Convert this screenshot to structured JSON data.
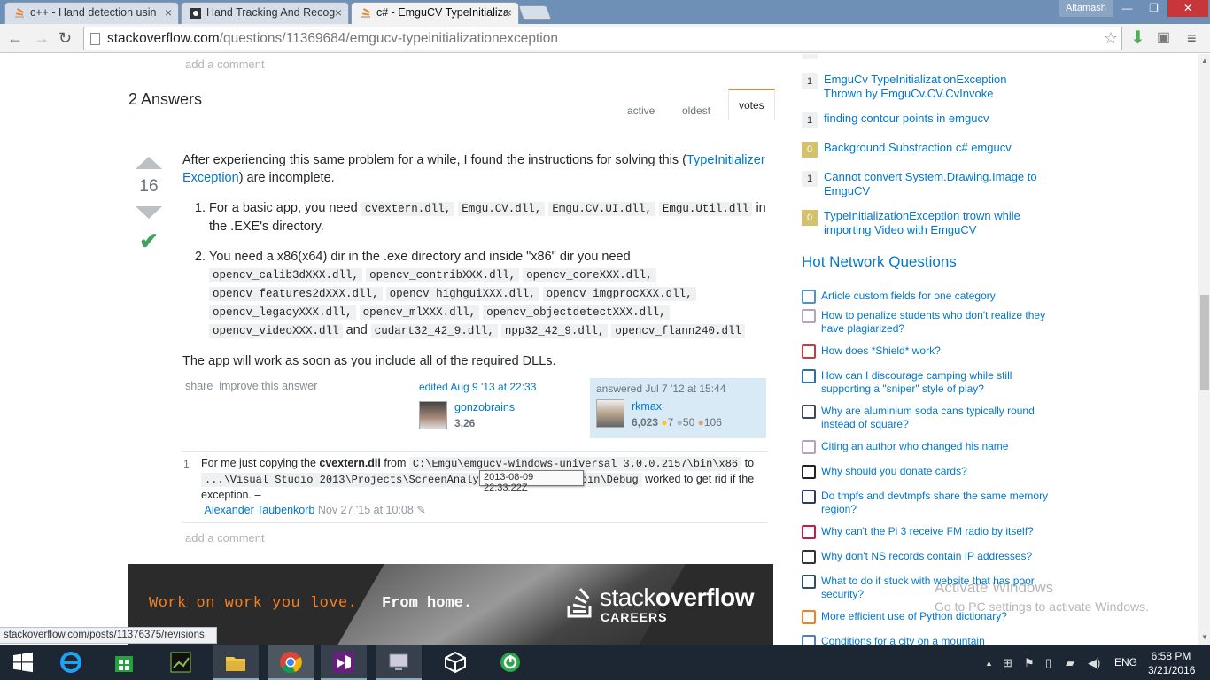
{
  "browser": {
    "tabs": [
      {
        "label": "c++ - Hand detection usin",
        "icon": "stackoverflow-icon"
      },
      {
        "label": "Hand Tracking And Recog",
        "icon": "page-icon"
      },
      {
        "label": "c# - EmguCV TypeInitializa",
        "icon": "stackoverflow-icon",
        "active": true
      }
    ],
    "user": "Altamash",
    "url_domain": "stackoverflow.com",
    "url_path": "/questions/11369684/emgucv-typeinitializationexception",
    "status_url": "stackoverflow.com/posts/11376375/revisions"
  },
  "question": {
    "add_comment": "add a comment"
  },
  "answers": {
    "title": "2 Answers",
    "sort_tabs": [
      "active",
      "oldest",
      "votes"
    ],
    "selected_sort": "votes"
  },
  "answer": {
    "score": "16",
    "intro_1": "After experiencing this same problem for a while, I found the instructions for solving this",
    "intro_link": "TypeInitializer Exception",
    "intro_2": "are incomplete.",
    "step1_text": "For a basic app, you need",
    "step1_dlls": [
      "cvextern.dll,",
      "Emgu.CV.dll,",
      "Emgu.CV.UI.dll,",
      "Emgu.Util.dll"
    ],
    "step1_tail": "in the .EXE's directory.",
    "step2_text": "You need a x86(x64) dir in the .exe directory and inside \"x86\" dir you need",
    "step2_dlls": [
      "opencv_calib3dXXX.dll,",
      "opencv_contribXXX.dll,",
      "opencv_coreXXX.dll,",
      "opencv_features2dXXX.dll,",
      "opencv_highguiXXX.dll,",
      "opencv_imgprocXXX.dll,",
      "opencv_legacyXXX.dll,",
      "opencv_mlXXX.dll,",
      "opencv_objectdetectXXX.dll,",
      "opencv_videoXXX.dll"
    ],
    "step2_and": "and",
    "step2_dlls2": [
      "cudart32_42_9.dll,",
      "npp32_42_9.dll,",
      "opencv_flann240.dll"
    ],
    "closing": "The app will work as soon as you include all of the required DLLs.",
    "menu_share": "share",
    "menu_improve": "improve this answer",
    "edited": {
      "label": "edited Aug 9 '13 at 22:33",
      "user": "gonzobrains",
      "rep": "3,26",
      "tooltip": "2013-08-09 22:33:22Z"
    },
    "owner": {
      "label": "answered Jul 7 '12 at 15:44",
      "user": "rkmax",
      "rep": "6,023",
      "gold": "7",
      "silver": "50",
      "bronze": "106"
    }
  },
  "comment": {
    "score": "1",
    "t1": "For me just copying the",
    "bold": "cvextern.dll",
    "t2": "from",
    "code1": "C:\\Emgu\\emgucv-windows-universal 3.0.0.2157\\bin\\x86",
    "t3": "to",
    "code2": "...\\Visual Studio 2013\\Projects\\ScreenAnalyzer\\TestProject\\bin\\Debug",
    "t4": "worked to get rid if the exception. –",
    "author": "Alexander Taubenkorb",
    "date": "Nov 27 '15 at 10:08",
    "add_comment": "add a comment"
  },
  "banner": {
    "t1": "Work on work you love.",
    "t2": "From home.",
    "logo_stack": "stack",
    "logo_overflow": "overflow",
    "careers": "CAREERS"
  },
  "related": [
    {
      "score": "1",
      "title": "EmguCv TypeInitializationException Thrown by EmguCv.CV.CvInvoke",
      "kind": "plain"
    },
    {
      "score": "1",
      "title": "finding contour points in emgucv",
      "kind": "plain"
    },
    {
      "score": "0",
      "title": "Background Substraction c# emgucv",
      "kind": "zero"
    },
    {
      "score": "1",
      "title": "Cannot convert System.Drawing.Image to EmguCV",
      "kind": "plain"
    },
    {
      "score": "0",
      "title": "TypeInitializationException trown while importing Video with EmguCV",
      "kind": "zero"
    }
  ],
  "hnq": {
    "title": "Hot Network Questions",
    "items": [
      {
        "title": "Article custom fields for one category",
        "icon": "joomla-icon",
        "color": "#5091cd"
      },
      {
        "title": "How to penalize students who don't realize they have plagiarized?",
        "icon": "academia-icon",
        "color": "#b6a1c5"
      },
      {
        "title": "How does *Shield* work?",
        "icon": "rpg-icon",
        "color": "#c23d3d"
      },
      {
        "title": "How can I discourage camping while still supporting a \"sniper\" style of play?",
        "icon": "gamedev-icon",
        "color": "#2a6db5"
      },
      {
        "title": "Why are aluminium soda cans typically round instead of square?",
        "icon": "engineering-icon",
        "color": "#3b4a5e"
      },
      {
        "title": "Citing an author who changed his name",
        "icon": "academia-icon",
        "color": "#b6a1c5"
      },
      {
        "title": "Why should you donate cards?",
        "icon": "boardgames-icon",
        "color": "#222"
      },
      {
        "title": "Do tmpfs and devtmpfs share the same memory region?",
        "icon": "unix-icon",
        "color": "#2b3a6a"
      },
      {
        "title": "Why can't the Pi 3 receive FM radio by itself?",
        "icon": "raspberrypi-icon",
        "color": "#c51a4a"
      },
      {
        "title": "Why don't NS records contain IP addresses?",
        "icon": "serverfault-icon",
        "color": "#333"
      },
      {
        "title": "What to do if stuck with website that has poor security?",
        "icon": "security-icon",
        "color": "#2c4f6a"
      },
      {
        "title": "More efficient use of Python dictionary?",
        "icon": "stackoverflow-icon",
        "color": "#f48024"
      },
      {
        "title": "Conditions for a city on a mountain",
        "icon": "worldbuilding-icon",
        "color": "#4a7fc4"
      }
    ]
  },
  "watermark": {
    "line1": "Activate Windows",
    "line2": "Go to PC settings to activate Windows."
  },
  "taskbar": {
    "lang": "ENG",
    "time": "6:58 PM",
    "date": "3/21/2016"
  }
}
